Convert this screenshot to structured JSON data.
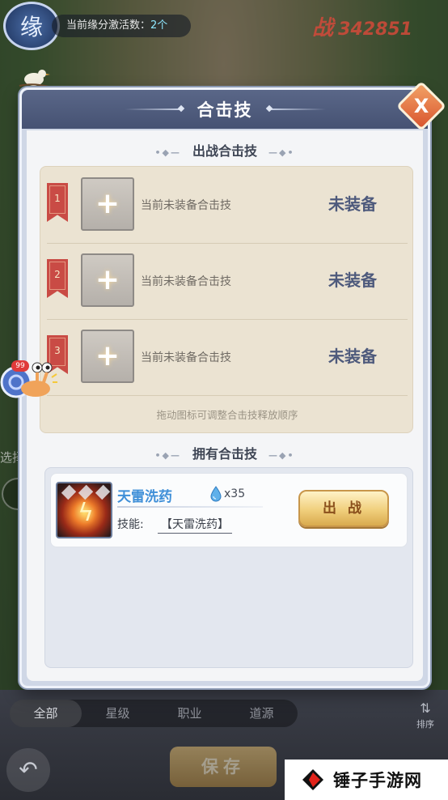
{
  "hud": {
    "fate_badge_char": "缘",
    "fate_label": "当前缘分激活数：",
    "fate_count": "2个",
    "power_char": "战",
    "power_value": "342851"
  },
  "modal": {
    "title": "合击技",
    "close_label": "X",
    "equipped_section_title": "出战合击技",
    "slots": [
      {
        "index": "1",
        "text": "当前未装备合击技",
        "status": "未装备"
      },
      {
        "index": "2",
        "text": "当前未装备合击技",
        "status": "未装备"
      },
      {
        "index": "3",
        "text": "当前未装备合击技",
        "status": "未装备"
      }
    ],
    "drag_tip": "拖动图标可调整合击技释放顺序",
    "owned_section_title": "拥有合击技",
    "owned_skills": [
      {
        "name": "天雷洗药",
        "count": "x35",
        "skill_label": "技能:",
        "skill_value": "【天雷洗药】",
        "action_label": "出 战"
      }
    ]
  },
  "side": {
    "badge_count": "99",
    "left_text": "选择"
  },
  "bottom": {
    "filter_tabs": [
      "全部",
      "星级",
      "职业",
      "道源"
    ],
    "sort_label": "排序",
    "save_label": "保存"
  },
  "watermark": {
    "text": "锤子手游网"
  },
  "colors": {
    "modal_header": "#4f5b7c",
    "slot_status": "#4e5a7c",
    "ribbon_red": "#c94b45",
    "skill_name_blue": "#3f8fd8",
    "battle_button_gold": "#f0cf7c",
    "close_button_orange": "#e4743f"
  }
}
